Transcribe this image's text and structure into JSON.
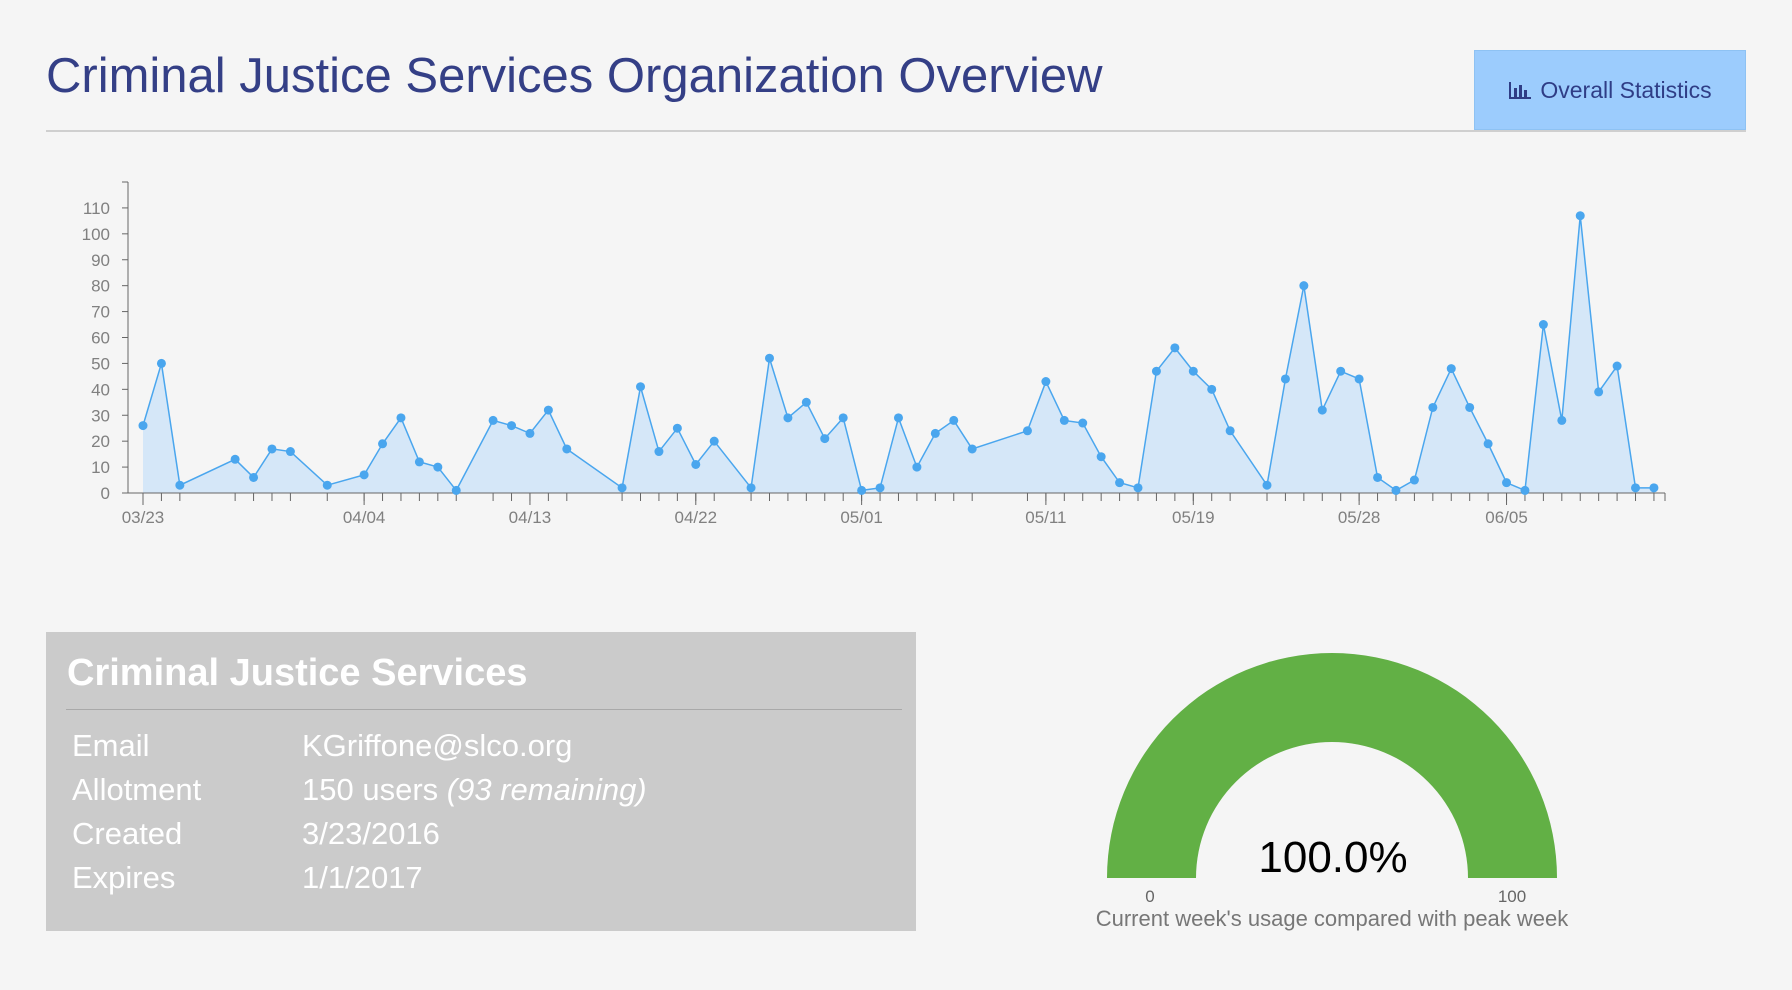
{
  "header": {
    "title": "Criminal Justice Services Organization Overview",
    "stats_button_label": "Overall Statistics",
    "stats_button_icon": "bar-chart-icon"
  },
  "colors": {
    "title": "#343f86",
    "button_bg": "#9cccfd",
    "line": "#4aa6ee",
    "area": "#d5e7f8",
    "gauge": "#62b045",
    "card_bg": "#cbcbcb"
  },
  "chart_data": {
    "type": "area",
    "title": "",
    "xlabel": "",
    "ylabel": "",
    "ylim": [
      0,
      120
    ],
    "yticks": [
      0,
      10,
      20,
      30,
      40,
      50,
      60,
      70,
      80,
      90,
      100,
      110
    ],
    "xlim": [
      "03/23",
      "06/12"
    ],
    "xtick_labels": [
      "03/23",
      "04/04",
      "04/13",
      "04/22",
      "05/01",
      "05/11",
      "05/19",
      "05/28",
      "06/05"
    ],
    "grid": false,
    "points": [
      [
        "03/23",
        26
      ],
      [
        "03/24",
        50
      ],
      [
        "03/25",
        3
      ],
      [
        "03/28",
        13
      ],
      [
        "03/29",
        6
      ],
      [
        "03/30",
        17
      ],
      [
        "03/31",
        16
      ],
      [
        "04/02",
        3
      ],
      [
        "04/04",
        7
      ],
      [
        "04/05",
        19
      ],
      [
        "04/06",
        29
      ],
      [
        "04/07",
        12
      ],
      [
        "04/08",
        10
      ],
      [
        "04/09",
        1
      ],
      [
        "04/11",
        28
      ],
      [
        "04/12",
        26
      ],
      [
        "04/13",
        23
      ],
      [
        "04/14",
        32
      ],
      [
        "04/15",
        17
      ],
      [
        "04/18",
        2
      ],
      [
        "04/19",
        41
      ],
      [
        "04/20",
        16
      ],
      [
        "04/21",
        25
      ],
      [
        "04/22",
        11
      ],
      [
        "04/23",
        20
      ],
      [
        "04/25",
        2
      ],
      [
        "04/26",
        52
      ],
      [
        "04/27",
        29
      ],
      [
        "04/28",
        35
      ],
      [
        "04/29",
        21
      ],
      [
        "04/30",
        29
      ],
      [
        "05/01",
        1
      ],
      [
        "05/02",
        2
      ],
      [
        "05/03",
        29
      ],
      [
        "05/04",
        10
      ],
      [
        "05/05",
        23
      ],
      [
        "05/06",
        28
      ],
      [
        "05/07",
        17
      ],
      [
        "05/10",
        24
      ],
      [
        "05/11",
        43
      ],
      [
        "05/12",
        28
      ],
      [
        "05/13",
        27
      ],
      [
        "05/14",
        14
      ],
      [
        "05/15",
        4
      ],
      [
        "05/16",
        2
      ],
      [
        "05/17",
        47
      ],
      [
        "05/18",
        56
      ],
      [
        "05/19",
        47
      ],
      [
        "05/20",
        40
      ],
      [
        "05/21",
        24
      ],
      [
        "05/23",
        3
      ],
      [
        "05/24",
        44
      ],
      [
        "05/25",
        80
      ],
      [
        "05/26",
        32
      ],
      [
        "05/27",
        47
      ],
      [
        "05/28",
        44
      ],
      [
        "05/29",
        6
      ],
      [
        "05/30",
        1
      ],
      [
        "05/31",
        5
      ],
      [
        "06/01",
        33
      ],
      [
        "06/02",
        48
      ],
      [
        "06/03",
        33
      ],
      [
        "06/04",
        19
      ],
      [
        "06/05",
        4
      ],
      [
        "06/06",
        1
      ],
      [
        "06/07",
        65
      ],
      [
        "06/08",
        28
      ],
      [
        "06/09",
        107
      ],
      [
        "06/10",
        39
      ],
      [
        "06/11",
        49
      ],
      [
        "06/12",
        2
      ],
      [
        "06/13",
        2
      ]
    ]
  },
  "org": {
    "name": "Criminal Justice Services",
    "rows": [
      {
        "label": "Email",
        "value": "KGriffone@slco.org",
        "extra": ""
      },
      {
        "label": "Allotment",
        "value": "150 users ",
        "extra": "(93 remaining)"
      },
      {
        "label": "Created",
        "value": "3/23/2016",
        "extra": ""
      },
      {
        "label": "Expires",
        "value": "1/1/2017",
        "extra": ""
      }
    ]
  },
  "gauge": {
    "value_text": "100.0%",
    "fraction": 1.0,
    "min_label": "0",
    "max_label": "100",
    "caption": "Current week's usage compared with peak week"
  }
}
